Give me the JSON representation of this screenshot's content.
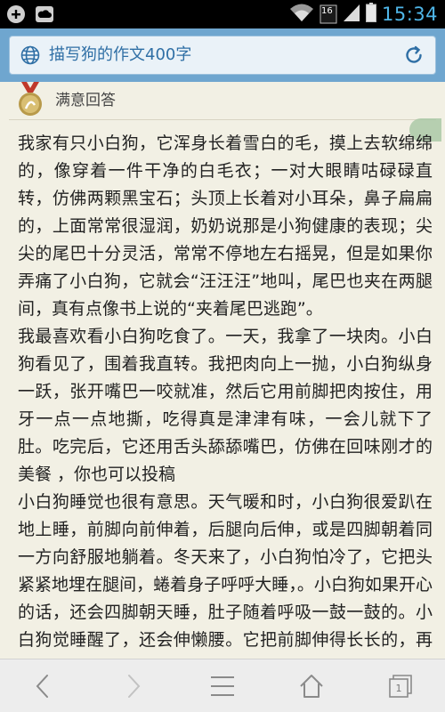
{
  "status_bar": {
    "time": "15:34",
    "sim_label": "16"
  },
  "address_bar": {
    "text": "描写狗的作文400字"
  },
  "answer_header": {
    "title": "满意回答"
  },
  "article": {
    "paragraphs": [
      "我家有只小白狗，它浑身长着雪白的毛，摸上去软绵绵的，像穿着一件干净的白毛衣；一对大眼睛咕碌碌直转，仿佛两颗黑宝石；头顶上长着对小耳朵，鼻子扁扁的，上面常常很湿润，奶奶说那是小狗健康的表现；尖尖的尾巴十分灵活，常常不停地左右摇晃，但是如果你弄痛了小白狗，它就会“汪汪汪”地叫，尾巴也夹在两腿间，真有点像书上说的“夹着尾巴逃跑”。",
      "我最喜欢看小白狗吃食了。一天，我拿了一块肉。小白狗看见了，围着我直转。我把肉向上一抛，小白狗纵身一跃，张开嘴巴一咬就准，然后它用前脚把肉按住，用牙一点一点地撕，吃得真是津津有味，一会儿就下了肚。吃完后，它还用舌头舔舔嘴巴，仿佛在回味刚才的美餐 ，你也可以投稿",
      "小白狗睡觉也很有意思。天气暖和时，小白狗很爱趴在地上睡，前脚向前伸着，后腿向后伸，或是四脚朝着同一方向舒服地躺着。冬天来了，小白狗怕冷了，它把头紧紧地埋在腿间，蜷着身子呼呼大睡，。小白狗如果开心的话，还会四脚朝天睡，肚子随着呼吸一鼓一鼓的。小白狗觉睡醒了，还会伸懒腰。它把前脚伸得长长的，再吸上一口气，把身子一拱，可爱极了"
    ]
  },
  "nav_bar": {
    "tab_count": "1"
  }
}
